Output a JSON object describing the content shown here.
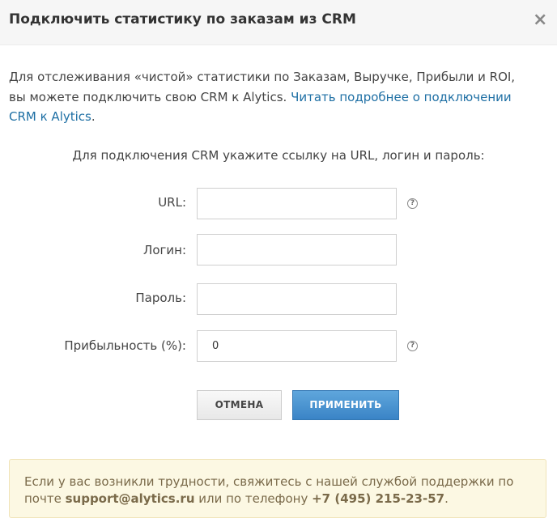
{
  "dialog": {
    "title": "Подключить статистику по заказам из CRM",
    "close_icon": "×"
  },
  "intro": {
    "text": "Для отслеживания «чистой» статистики по Заказам, Выручке, Прибыли и ROI, вы можете подключить свою CRM к Alytics. ",
    "link": "Читать подробнее о подключении CRM к Alytics",
    "end": "."
  },
  "form": {
    "subtitle": "Для подключения CRM укажите ссылку на URL, логин и пароль:",
    "url_label": "URL:",
    "url_value": "",
    "login_label": "Логин:",
    "login_value": "",
    "password_label": "Пароль:",
    "password_value": "",
    "profit_label": "Прибыльность (%):",
    "profit_value": "0",
    "help_glyph": "?"
  },
  "buttons": {
    "cancel": "ОТМЕНА",
    "apply": "ПРИМЕНИТЬ"
  },
  "notice": {
    "text1": "Если у вас возникли трудности, свяжитесь с нашей службой поддержки по почте ",
    "email": "support@alytics.ru",
    "text2": " или по телефону ",
    "phone": "+7 (495) 215-23-57",
    "end": "."
  },
  "colors": {
    "link": "#1e6fa4",
    "apply_button": "#3a84c6",
    "notice_bg": "#fcf8e3"
  }
}
